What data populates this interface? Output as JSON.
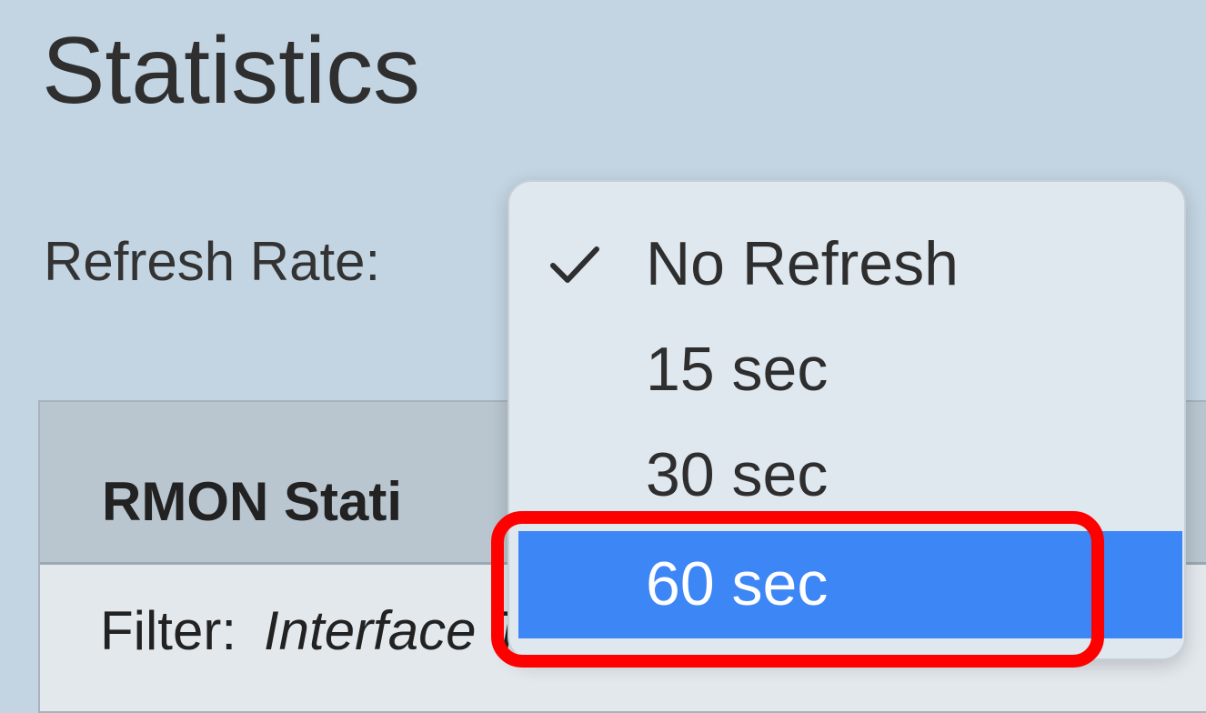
{
  "page": {
    "title": "Statistics"
  },
  "refresh": {
    "label": "Refresh Rate:",
    "selected": "No Refresh",
    "options": [
      {
        "label": "No Refresh",
        "checked": true
      },
      {
        "label": "15 sec",
        "checked": false
      },
      {
        "label": "30 sec",
        "checked": false
      },
      {
        "label": "60 sec",
        "checked": false,
        "hovered": true
      }
    ]
  },
  "panel": {
    "title": "RMON Stati",
    "filter_label": "Filter:",
    "filter_value": "Interface Type equals to"
  },
  "colors": {
    "background": "#c3d4e2",
    "menu_background": "#dfe7ef",
    "hover_highlight": "#3d86f5",
    "annotation_box": "#ff0000"
  },
  "icons": {
    "check": "check-icon",
    "caret": "chevron-down-icon"
  }
}
